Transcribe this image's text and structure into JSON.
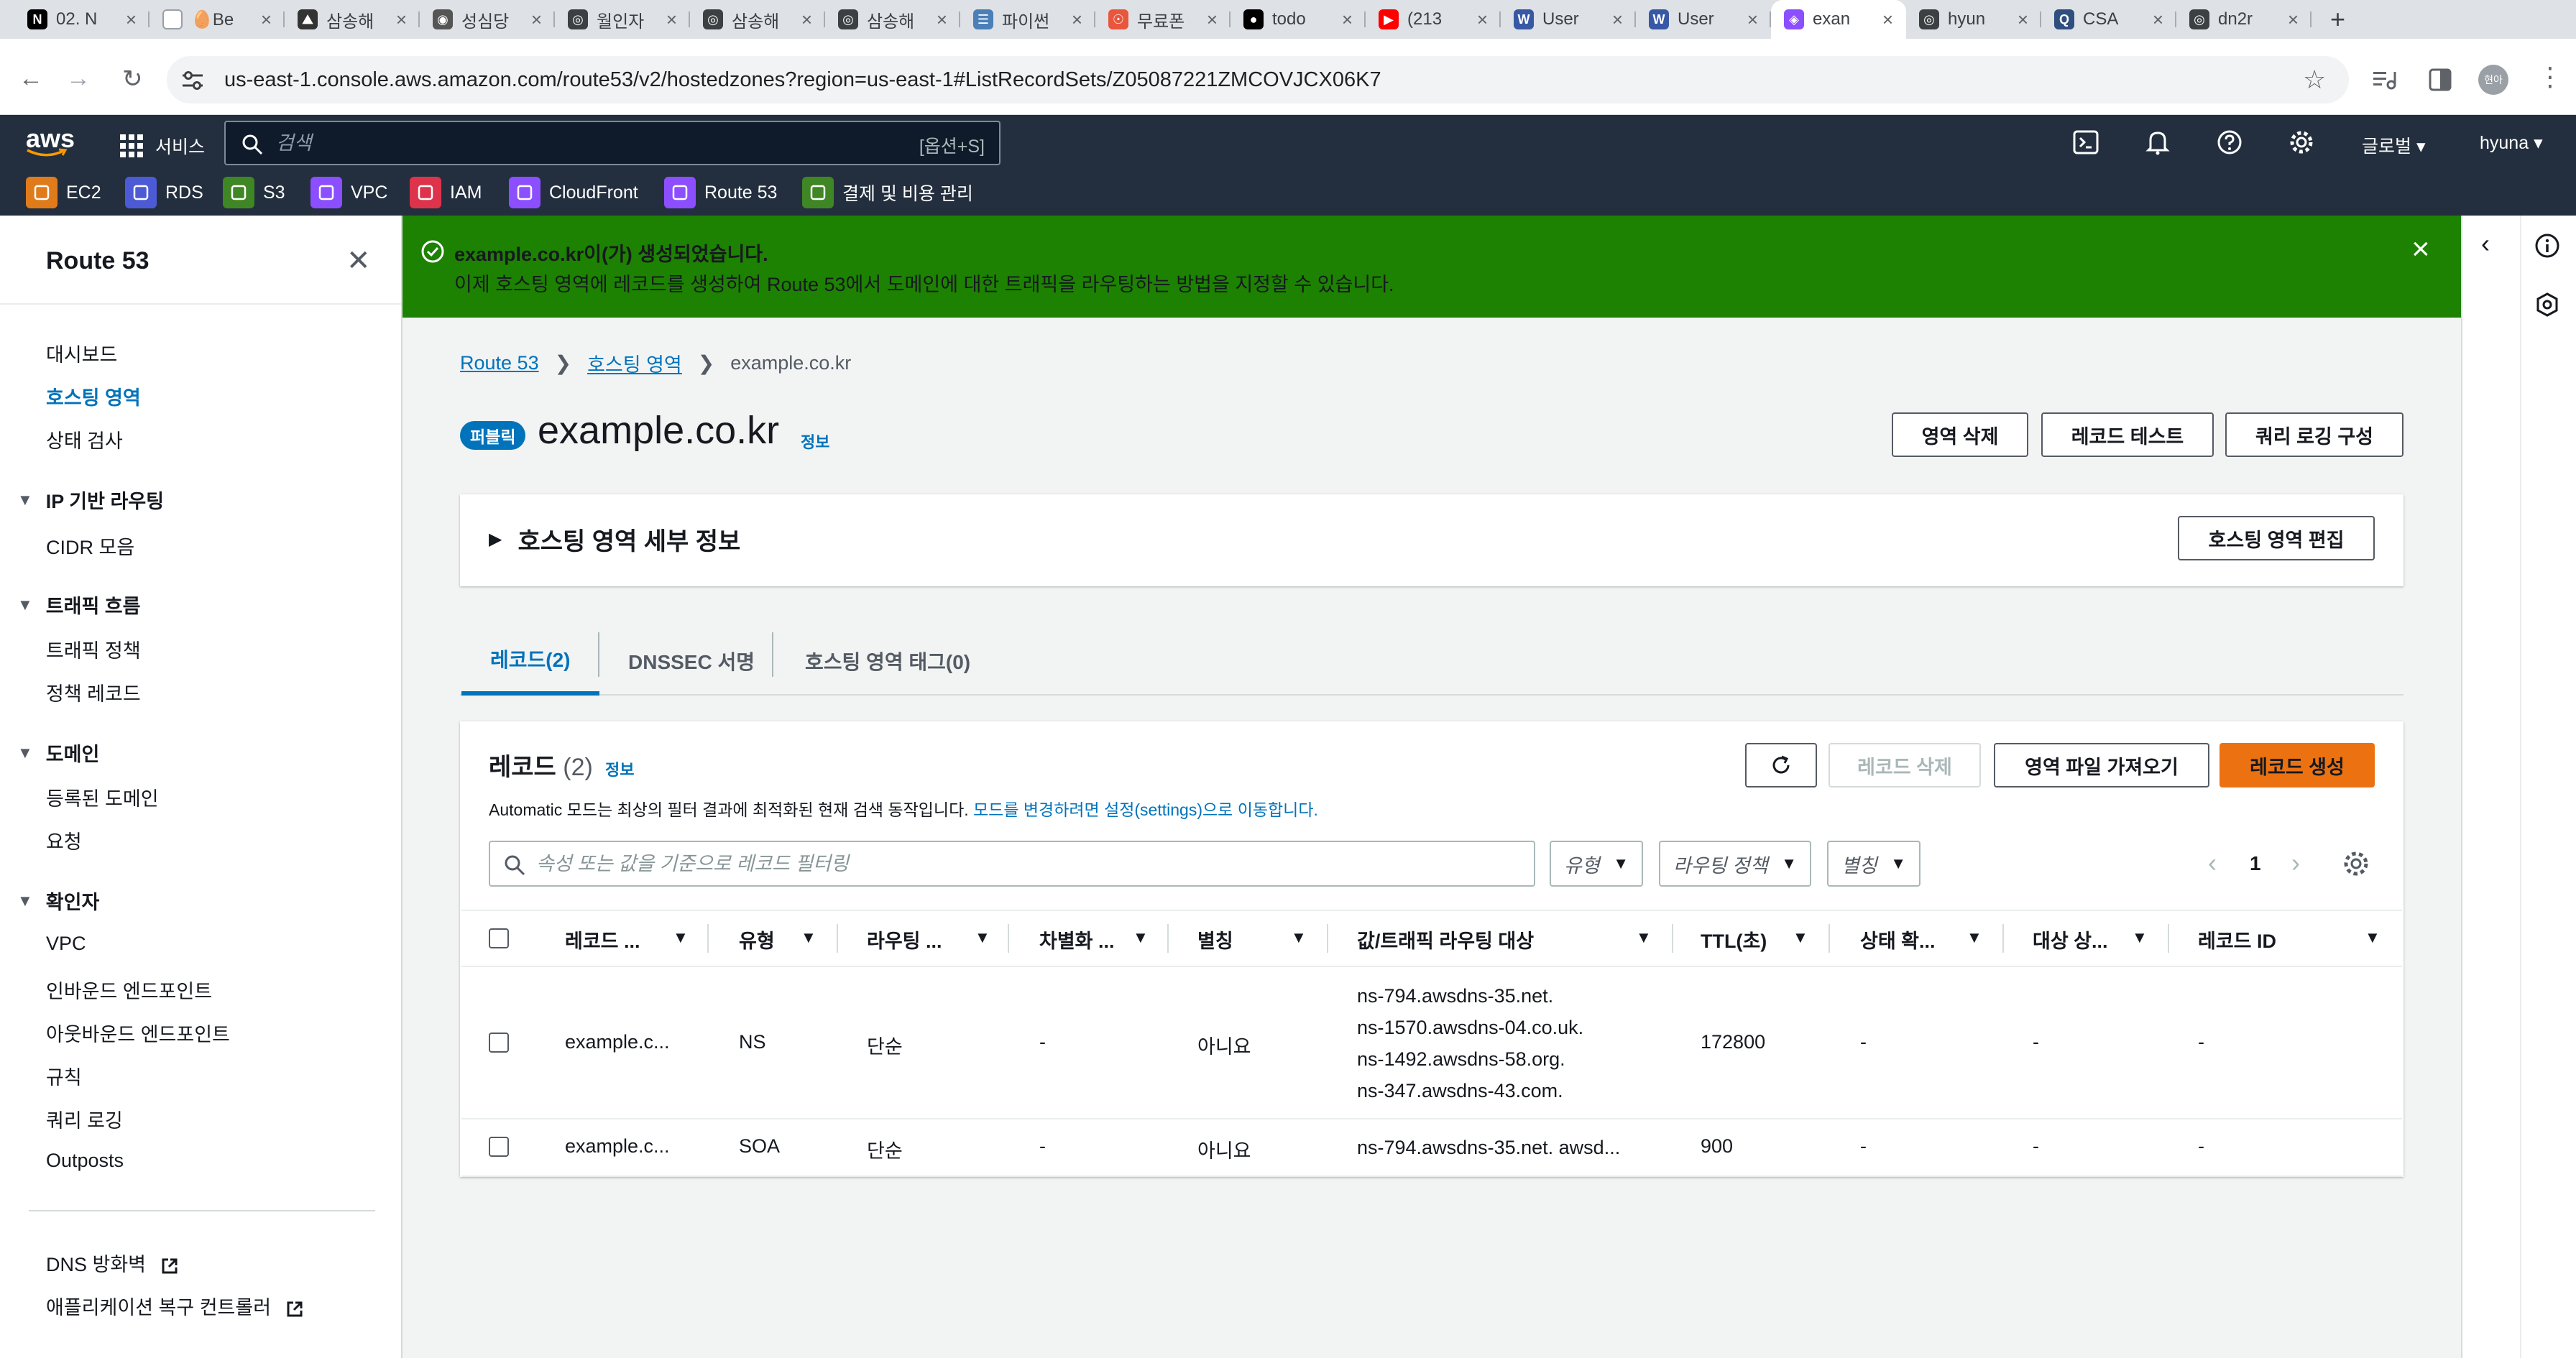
{
  "browser": {
    "tabs": [
      {
        "label": "02. N",
        "icon": "notion-icon",
        "color": "#000000",
        "glyph": "N"
      },
      {
        "label": "🥚Be",
        "icon": "page-icon",
        "color": "#ffffff",
        "glyph": ""
      },
      {
        "label": "삼송해",
        "icon": "velog-icon",
        "color": "#333333",
        "glyph": "⛰"
      },
      {
        "label": "성심당",
        "icon": "site-icon",
        "color": "#555555",
        "glyph": "◉"
      },
      {
        "label": "월인자",
        "icon": "globe-icon",
        "color": "#3c4043",
        "glyph": "◎"
      },
      {
        "label": "삼송해",
        "icon": "globe-icon",
        "color": "#3c4043",
        "glyph": "◎"
      },
      {
        "label": "삼송해",
        "icon": "globe-icon",
        "color": "#3c4043",
        "glyph": "◎"
      },
      {
        "label": "파이썬",
        "icon": "python-icon",
        "color": "#4a7fb8",
        "glyph": "☰"
      },
      {
        "label": "무료폰",
        "icon": "font-icon",
        "color": "#e8563e",
        "glyph": "☉"
      },
      {
        "label": "todo",
        "icon": "github-icon",
        "color": "#000000",
        "glyph": "●"
      },
      {
        "label": "(213",
        "icon": "youtube-icon",
        "color": "#ff0000",
        "glyph": "▶"
      },
      {
        "label": "User",
        "icon": "wordpress-icon",
        "color": "#3858a5",
        "glyph": "W"
      },
      {
        "label": "User",
        "icon": "wordpress-icon",
        "color": "#3858a5",
        "glyph": "W"
      },
      {
        "label": "exan",
        "icon": "route53-icon",
        "color": "#8c4fff",
        "glyph": "◈",
        "active": true
      },
      {
        "label": "hyun",
        "icon": "globe-icon",
        "color": "#3c4043",
        "glyph": "◎"
      },
      {
        "label": "CSA",
        "icon": "search-icon",
        "color": "#2f4f7f",
        "glyph": "Q"
      },
      {
        "label": "dn2r",
        "icon": "globe-icon",
        "color": "#3c4043",
        "glyph": "◎"
      }
    ],
    "new_tab": "+",
    "url": "us-east-1.console.aws.amazon.com/route53/v2/hostedzones?region=us-east-1#ListRecordSets/Z05087221ZMCOVJCX06K7",
    "profile": "현아"
  },
  "aws": {
    "logo": "aws",
    "services_label": "서비스",
    "search_placeholder": "검색",
    "search_shortcut": "[옵션+S]",
    "region": "글로벌",
    "user": "hyuna",
    "favorites": [
      {
        "label": "EC2",
        "color": "#e07b1b"
      },
      {
        "label": "RDS",
        "color": "#4d5ad6"
      },
      {
        "label": "S3",
        "color": "#3f8624"
      },
      {
        "label": "VPC",
        "color": "#8c4fff"
      },
      {
        "label": "IAM",
        "color": "#dd344c"
      },
      {
        "label": "CloudFront",
        "color": "#8c4fff"
      },
      {
        "label": "Route 53",
        "color": "#8c4fff"
      },
      {
        "label": "결제 및 비용 관리",
        "color": "#3f8624"
      }
    ]
  },
  "sidebar": {
    "title": "Route 53",
    "top_items": [
      "대시보드",
      "호스팅 영역",
      "상태 검사"
    ],
    "sections": [
      {
        "title": "IP 기반 라우팅",
        "items": [
          "CIDR 모음"
        ]
      },
      {
        "title": "트래픽 흐름",
        "items": [
          "트래픽 정책",
          "정책 레코드"
        ]
      },
      {
        "title": "도메인",
        "items": [
          "등록된 도메인",
          "요청"
        ]
      },
      {
        "title": "확인자",
        "items": [
          "VPC",
          "인바운드 엔드포인트",
          "아웃바운드 엔드포인트",
          "규칙",
          "쿼리 로깅",
          "Outposts"
        ]
      }
    ],
    "bottom_items": [
      "DNS 방화벽",
      "애플리케이션 복구 컨트롤러"
    ]
  },
  "flash": {
    "title": "example.co.kr이(가) 생성되었습니다.",
    "message": "이제 호스팅 영역에 레코드를 생성하여 Route 53에서 도메인에 대한 트래픽을 라우팅하는 방법을 지정할 수 있습니다."
  },
  "breadcrumb": {
    "root": "Route 53",
    "parent": "호스팅 영역",
    "current": "example.co.kr"
  },
  "zone": {
    "badge": "퍼블릭",
    "name": "example.co.kr",
    "info": "정보",
    "buttons": {
      "delete": "영역 삭제",
      "test": "레코드 테스트",
      "logging": "쿼리 로깅 구성"
    },
    "details_title": "호스팅 영역 세부 정보",
    "edit_button": "호스팅 영역 편집"
  },
  "tabs": [
    {
      "label": "레코드(2)"
    },
    {
      "label": "DNSSEC 서명"
    },
    {
      "label": "호스팅 영역 태그(0)"
    }
  ],
  "records": {
    "title": "레코드",
    "count": "(2)",
    "info": "정보",
    "desc": "Automatic 모드는 최상의 필터 결과에 최적화된 현재 검색 동작입니다.",
    "desc_link": "모드를 변경하려면 설정(settings)으로 이동합니다.",
    "buttons": {
      "delete": "레코드 삭제",
      "import": "영역 파일 가져오기",
      "create": "레코드 생성"
    },
    "filter_placeholder": "속성 또는 값을 기준으로 레코드 필터링",
    "selects": [
      "유형",
      "라우팅 정책",
      "별칭"
    ],
    "page": "1",
    "columns": [
      "레코드 ...",
      "유형",
      "라우팅 ...",
      "차별화 ...",
      "별칭",
      "값/트래픽 라우팅 대상",
      "TTL(초)",
      "상태 확...",
      "대상 상...",
      "레코드 ID"
    ],
    "rows": [
      {
        "name": "example.c...",
        "type": "NS",
        "routing": "단순",
        "diff": "-",
        "alias": "아니요",
        "values": [
          "ns-794.awsdns-35.net.",
          "ns-1570.awsdns-04.co.uk.",
          "ns-1492.awsdns-58.org.",
          "ns-347.awsdns-43.com."
        ],
        "ttl": "172800",
        "health": "-",
        "target": "-",
        "id": "-"
      },
      {
        "name": "example.c...",
        "type": "SOA",
        "routing": "단순",
        "diff": "-",
        "alias": "아니요",
        "values": [
          "ns-794.awsdns-35.net. awsd..."
        ],
        "ttl": "900",
        "health": "-",
        "target": "-",
        "id": "-"
      }
    ]
  }
}
